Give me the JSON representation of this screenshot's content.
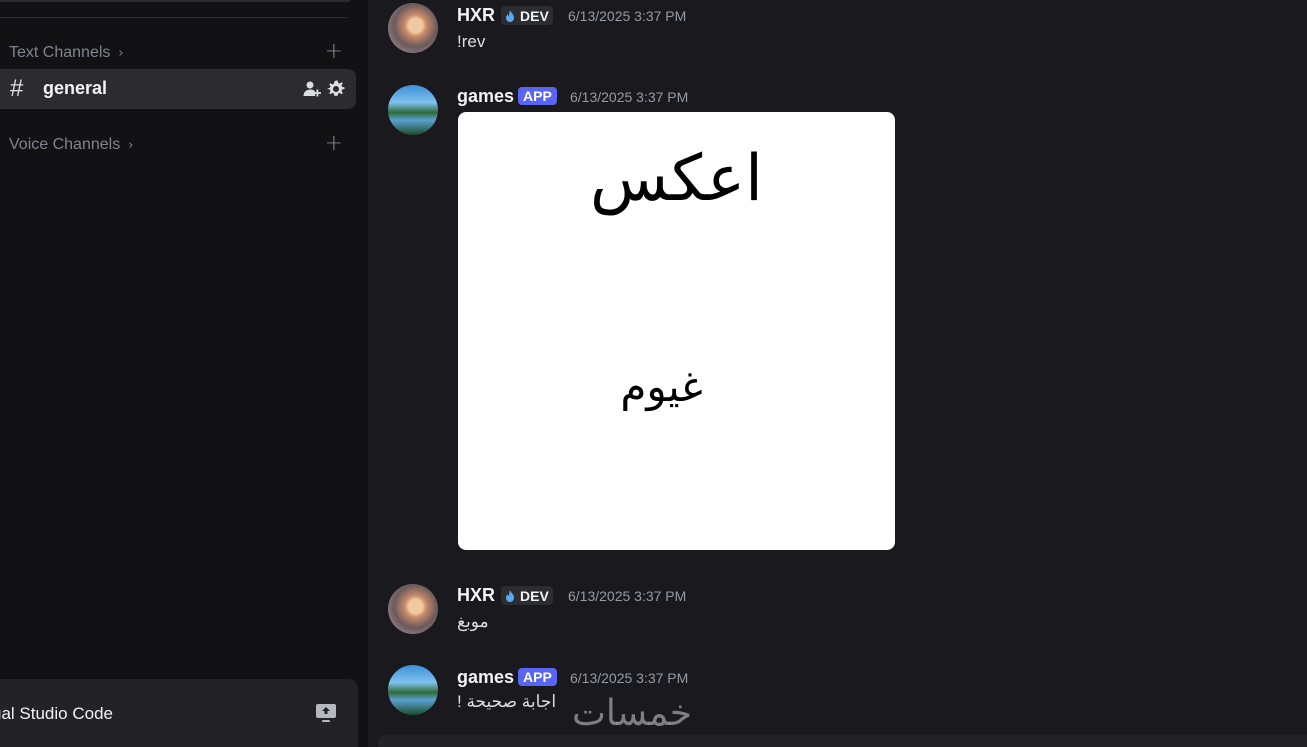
{
  "sidebar": {
    "text_category": "Text Channels",
    "voice_category": "Voice Channels",
    "active_channel": "general",
    "bottom_app": "ual Studio Code"
  },
  "messages": [
    {
      "author": "HXR",
      "badge": "DEV",
      "timestamp": "6/13/2025 3:37 PM",
      "text": "!rev"
    },
    {
      "author": "games",
      "badge": "APP",
      "timestamp": "6/13/2025 3:37 PM",
      "image": {
        "line1": "اعكس",
        "line2": "غيوم"
      }
    },
    {
      "author": "HXR",
      "badge": "DEV",
      "timestamp": "6/13/2025 3:37 PM",
      "text": "موبغ"
    },
    {
      "author": "games",
      "badge": "APP",
      "timestamp": "6/13/2025 3:37 PM",
      "text": "اجابة صحيحة !"
    }
  ],
  "watermark": "خمسات",
  "colors": {
    "app_badge": "#5865f2",
    "background": "#1a1a1e",
    "sidebar": "#121214"
  }
}
